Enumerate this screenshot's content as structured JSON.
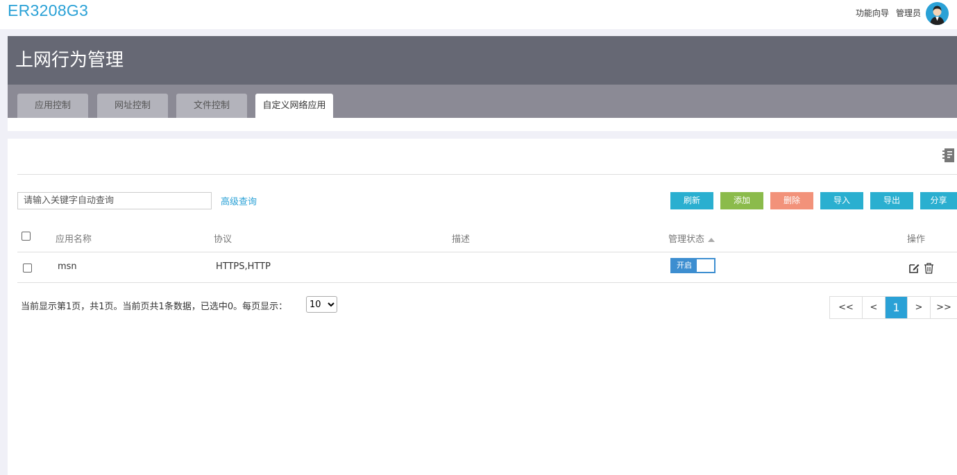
{
  "app": {
    "brand": "ER3208G3",
    "wizard_link": "功能向导",
    "user_label": "管理员"
  },
  "page": {
    "title": "上网行为管理"
  },
  "tabs": [
    {
      "label": "应用控制",
      "active": false
    },
    {
      "label": "网址控制",
      "active": false
    },
    {
      "label": "文件控制",
      "active": false
    },
    {
      "label": "自定义网络应用",
      "active": true
    }
  ],
  "toolbar": {
    "search_placeholder": "请输入关键字自动查询",
    "advanced_search": "高级查询",
    "buttons": [
      {
        "label": "刷新",
        "color": "#2aafd0"
      },
      {
        "label": "添加",
        "color": "#8bbb4b"
      },
      {
        "label": "删除",
        "color": "#f2927a"
      },
      {
        "label": "导入",
        "color": "#2aafd0"
      },
      {
        "label": "导出",
        "color": "#2aafd0"
      },
      {
        "label": "分享",
        "color": "#2aafd0"
      }
    ]
  },
  "table": {
    "columns": {
      "name": "应用名称",
      "protocol": "协议",
      "description": "描述",
      "status": "管理状态",
      "actions": "操作"
    },
    "rows": [
      {
        "name": "msn",
        "protocol": "HTTPS,HTTP",
        "description": "",
        "status_label": "开启",
        "checked": false
      }
    ]
  },
  "footer": {
    "page_info": "当前显示第1页，共1页。当前页共1条数据，已选中0。每页显示：",
    "page_size": "10",
    "page_size_options": [
      "10"
    ]
  },
  "pager": {
    "first": "<<",
    "prev": "<",
    "current": "1",
    "next": ">",
    "last": ">>"
  },
  "colors": {
    "accent": "#2aa1d6",
    "header_bg": "#666874",
    "tabbar_bg": "#8b8a95",
    "toggle_on": "#3d8ed0"
  }
}
